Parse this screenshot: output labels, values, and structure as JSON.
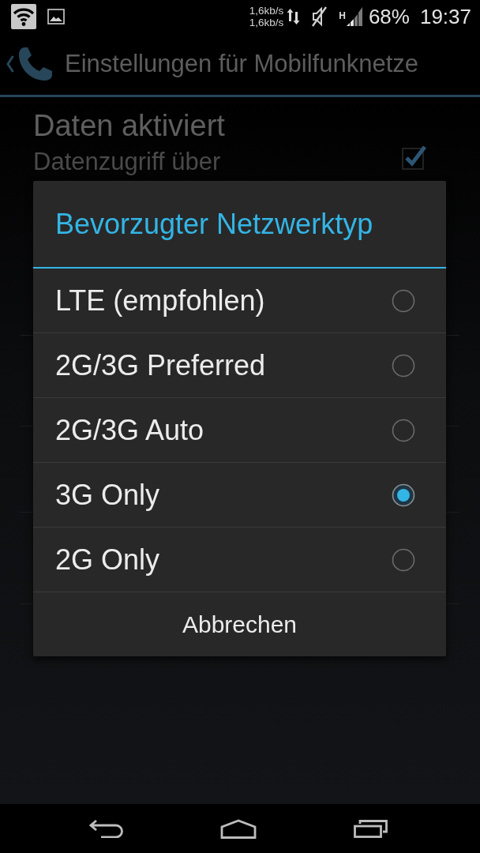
{
  "status_bar": {
    "upload_rate": "1,6kb/s",
    "download_rate": "1,6kb/s",
    "network_type": "H",
    "battery": "68%",
    "time": "19:37"
  },
  "action_bar": {
    "title": "Einstellungen für Mobilfunknetze"
  },
  "settings": [
    {
      "title": "Daten aktiviert",
      "summary": "Datenzugriff über",
      "checked": true
    }
  ],
  "dialog": {
    "title": "Bevorzugter Netzwerktyp",
    "options": [
      {
        "label": "LTE (empfohlen)",
        "selected": false
      },
      {
        "label": "2G/3G Preferred",
        "selected": false
      },
      {
        "label": "2G/3G Auto",
        "selected": false
      },
      {
        "label": "3G Only",
        "selected": true
      },
      {
        "label": "2G Only",
        "selected": false
      }
    ],
    "cancel": "Abbrechen"
  }
}
